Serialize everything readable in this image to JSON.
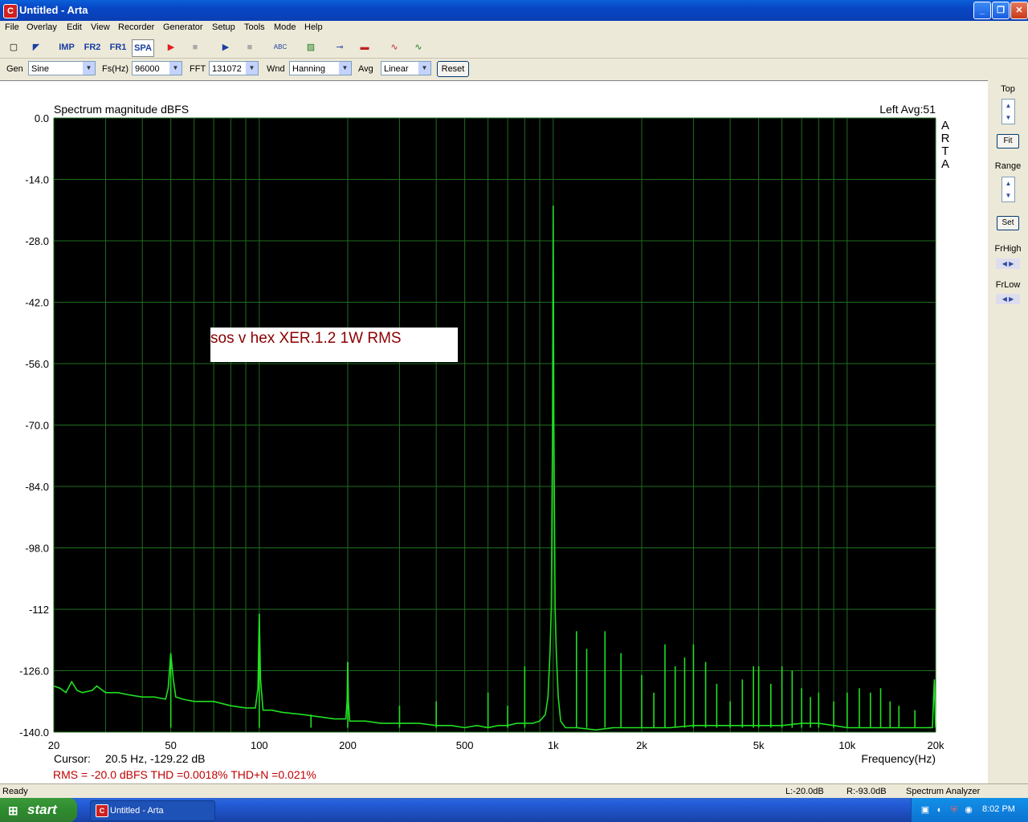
{
  "window": {
    "title": "Untitled - Arta",
    "app_icon_letter": "C"
  },
  "menu": [
    "File",
    "Overlay",
    "Edit",
    "View",
    "Recorder",
    "Generator",
    "Setup",
    "Tools",
    "Mode",
    "Help"
  ],
  "toolbar": {
    "new_icon": "new-file-icon",
    "open_icon": "open-icon",
    "imp": "IMP",
    "fr2": "FR2",
    "fr1": "FR1",
    "spa": "SPA",
    "record_icon": "record-icon",
    "stop_icon": "stop-icon",
    "play_icon": "play-icon",
    "stop2_icon": "stop-icon",
    "abc_icon": "abc-icon",
    "wave_icon": "wave-icon",
    "slider_icon": "slider-icon",
    "meter_icon": "meter-icon",
    "scope_icon": "scope-icon",
    "green_icon": "generator-icon"
  },
  "params": {
    "gen_label": "Gen",
    "gen_value": "Sine",
    "fs_label": "Fs(Hz)",
    "fs_value": "96000",
    "fft_label": "FFT",
    "fft_value": "131072",
    "wnd_label": "Wnd",
    "wnd_value": "Hanning",
    "avg_label": "Avg",
    "avg_value": "Linear",
    "reset": "Reset"
  },
  "right_panel": {
    "top": "Top",
    "fit": "Fit",
    "range": "Range",
    "set": "Set",
    "frhigh": "FrHigh",
    "frlow": "FrLow"
  },
  "chart_data": {
    "type": "line",
    "title": "Spectrum magnitude dBFS",
    "channel_info": "Left  Avg:51",
    "brand": [
      "A",
      "R",
      "T",
      "A"
    ],
    "xlabel": "Frequency(Hz)",
    "x_scale": "log",
    "xlim": [
      20,
      20000
    ],
    "ylim": [
      -140,
      0
    ],
    "yticks": [
      0,
      -14,
      -28,
      -42,
      -56,
      -70,
      -84,
      -98,
      -112,
      -126,
      -140
    ],
    "ytick_labels": [
      "0.0",
      "-14.0",
      "-28.0",
      "-42.0",
      "-56.0",
      "-70.0",
      "-84.0",
      "-98.0",
      "-112",
      "-126.0",
      "-140.0"
    ],
    "xtick_labels": [
      {
        "x": 20,
        "label": "20"
      },
      {
        "x": 50,
        "label": "50"
      },
      {
        "x": 100,
        "label": "100"
      },
      {
        "x": 200,
        "label": "200"
      },
      {
        "x": 500,
        "label": "500"
      },
      {
        "x": 1000,
        "label": "1k"
      },
      {
        "x": 2000,
        "label": "2k"
      },
      {
        "x": 5000,
        "label": "5k"
      },
      {
        "x": 10000,
        "label": "10k"
      },
      {
        "x": 20000,
        "label": "20k"
      }
    ],
    "grid": true,
    "annotation": "sos v hex XER.1.2  1W RMS",
    "cursor_label": "Cursor:",
    "cursor_value": "20.5 Hz, -129.22 dB",
    "measurements": "RMS =  -20.0 dBFS   THD =0.0018%   THD+N =0.021%",
    "colors": {
      "trace": "#20e020",
      "background": "#000000",
      "grid": "#1e6e1e"
    },
    "series": [
      {
        "points": [
          [
            20,
            -129.5
          ],
          [
            21,
            -130
          ],
          [
            22,
            -131
          ],
          [
            23,
            -128.5
          ],
          [
            24,
            -130.5
          ],
          [
            25,
            -131
          ],
          [
            27,
            -130.5
          ],
          [
            28,
            -129.5
          ],
          [
            30,
            -131
          ],
          [
            33,
            -131
          ],
          [
            36,
            -131.5
          ],
          [
            40,
            -132
          ],
          [
            44,
            -132
          ],
          [
            48,
            -132.5
          ],
          [
            49,
            -130
          ],
          [
            50,
            -122
          ],
          [
            51,
            -128
          ],
          [
            52,
            -132
          ],
          [
            55,
            -132.5
          ],
          [
            60,
            -133
          ],
          [
            65,
            -133
          ],
          [
            70,
            -133
          ],
          [
            80,
            -134
          ],
          [
            90,
            -134.5
          ],
          [
            97,
            -134.5
          ],
          [
            99,
            -130
          ],
          [
            100,
            -113
          ],
          [
            101,
            -128
          ],
          [
            103,
            -135
          ],
          [
            110,
            -135
          ],
          [
            120,
            -135.5
          ],
          [
            140,
            -136
          ],
          [
            160,
            -136.5
          ],
          [
            180,
            -137
          ],
          [
            197,
            -137
          ],
          [
            199,
            -133
          ],
          [
            200,
            -124
          ],
          [
            201,
            -133
          ],
          [
            203,
            -137.5
          ],
          [
            230,
            -137.5
          ],
          [
            260,
            -138
          ],
          [
            300,
            -138
          ],
          [
            350,
            -138
          ],
          [
            400,
            -138.5
          ],
          [
            450,
            -138.5
          ],
          [
            500,
            -139
          ],
          [
            550,
            -138.5
          ],
          [
            600,
            -139
          ],
          [
            650,
            -138.5
          ],
          [
            700,
            -138.5
          ],
          [
            750,
            -138
          ],
          [
            800,
            -138
          ],
          [
            850,
            -138
          ],
          [
            900,
            -137.5
          ],
          [
            940,
            -136
          ],
          [
            960,
            -132
          ],
          [
            975,
            -122
          ],
          [
            985,
            -112
          ],
          [
            995,
            -70
          ],
          [
            1000,
            -20
          ],
          [
            1005,
            -70
          ],
          [
            1015,
            -112
          ],
          [
            1025,
            -122
          ],
          [
            1040,
            -132
          ],
          [
            1060,
            -137.5
          ],
          [
            1100,
            -139
          ],
          [
            1200,
            -139
          ],
          [
            1400,
            -139.5
          ],
          [
            1600,
            -139
          ],
          [
            2000,
            -139
          ],
          [
            2500,
            -139
          ],
          [
            3000,
            -138.5
          ],
          [
            4000,
            -138.5
          ],
          [
            5000,
            -138.5
          ],
          [
            6000,
            -138.5
          ],
          [
            7000,
            -138
          ],
          [
            8000,
            -138
          ],
          [
            9000,
            -138.5
          ],
          [
            10000,
            -139
          ],
          [
            12000,
            -139
          ],
          [
            15000,
            -139
          ],
          [
            18000,
            -139
          ],
          [
            19500,
            -139
          ],
          [
            19800,
            -128
          ],
          [
            20000,
            -139
          ]
        ]
      },
      {
        "points": [
          [
            50,
            -122
          ],
          [
            100,
            -113
          ],
          [
            150,
            -136
          ],
          [
            200,
            -124
          ],
          [
            300,
            -134
          ],
          [
            400,
            -133
          ],
          [
            600,
            -131
          ],
          [
            700,
            -134
          ],
          [
            800,
            -125
          ],
          [
            1200,
            -117
          ],
          [
            1300,
            -121
          ],
          [
            1500,
            -117
          ],
          [
            1700,
            -122
          ],
          [
            2000,
            -127
          ],
          [
            2200,
            -131
          ],
          [
            2400,
            -120
          ],
          [
            2600,
            -125
          ],
          [
            2800,
            -123
          ],
          [
            3000,
            -120
          ],
          [
            3300,
            -124
          ],
          [
            3600,
            -129
          ],
          [
            4000,
            -133
          ],
          [
            4400,
            -128
          ],
          [
            4800,
            -125
          ],
          [
            5000,
            -125
          ],
          [
            5500,
            -129
          ],
          [
            6000,
            -125
          ],
          [
            6500,
            -126
          ],
          [
            7000,
            -130
          ],
          [
            7500,
            -132
          ],
          [
            8000,
            -131
          ],
          [
            9000,
            -133
          ],
          [
            10000,
            -131
          ],
          [
            11000,
            -130
          ],
          [
            12000,
            -131
          ],
          [
            13000,
            -130
          ],
          [
            14000,
            -133
          ],
          [
            15000,
            -134
          ],
          [
            17000,
            -135
          ]
        ]
      }
    ]
  },
  "status": {
    "ready": "Ready",
    "left_level": "L:-20.0dB",
    "right_level": "R:-93.0dB",
    "mode": "Spectrum Analyzer"
  },
  "taskbar": {
    "start": "start",
    "task_item": "Untitled - Arta",
    "clock": "8:02 PM"
  }
}
